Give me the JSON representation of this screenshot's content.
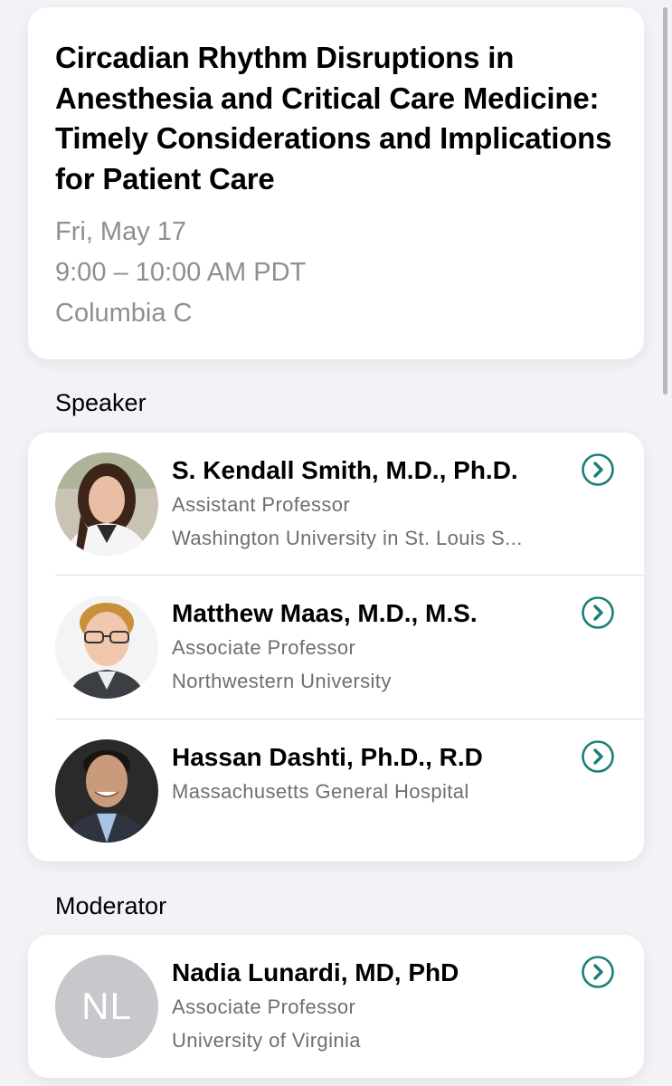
{
  "session": {
    "title": "Circadian Rhythm Disruptions in Anesthesia and Critical Care Medicine: Timely Considerations and Implications for Patient Care",
    "date": "Fri, May 17",
    "time": "9:00 – 10:00 AM PDT",
    "location": "Columbia C"
  },
  "speakers_section": {
    "label": "Speaker",
    "items": [
      {
        "name": "S. Kendall Smith, M.D., Ph.D.",
        "line1": "Assistant Professor",
        "line2": "Washington University in St. Louis S..."
      },
      {
        "name": "Matthew Maas, M.D., M.S.",
        "line1": "Associate Professor",
        "line2": "Northwestern University"
      },
      {
        "name": "Hassan Dashti, Ph.D., R.D",
        "line1": "Massachusetts General Hospital"
      }
    ]
  },
  "moderator_section": {
    "label": "Moderator",
    "items": [
      {
        "name": "Nadia Lunardi, MD, PhD",
        "initials": "NL",
        "line1": "Associate Professor",
        "line2": "University of Virginia"
      }
    ]
  },
  "icons": {
    "chevron": "chevron-right-circle-icon"
  },
  "colors": {
    "accent": "#1a7f7a",
    "background": "#f2f2f7",
    "card": "#ffffff",
    "secondary_text": "#8e8e93"
  }
}
